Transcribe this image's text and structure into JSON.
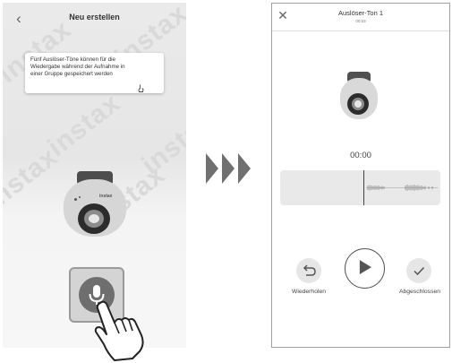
{
  "left_screen": {
    "title": "Neu erstellen",
    "back_icon": "chevron-left-icon",
    "tooltip": {
      "line1": "Fünf Auslöser-Töne können für die",
      "line2": "Wiedergabe während der Aufnahme in",
      "line3": "einer Gruppe gespeichert werden"
    },
    "watermark": "instax",
    "camera_brand": "instax",
    "mic_icon": "microphone-icon"
  },
  "arrow_icon": "triple-chevron-right-icon",
  "right_screen": {
    "title": "Auslöser-Ton 1",
    "subtitle_time": "00:03",
    "close_icon": "close-icon",
    "timer": "00:00",
    "undo_label": "Wiederholen",
    "done_label": "Abgeschlossen",
    "icons": {
      "undo": "undo-icon",
      "play": "play-icon",
      "done": "checkmark-icon"
    }
  },
  "colors": {
    "screen_bg": "#e8e8e8",
    "camera_top": "#4d4d4d",
    "arrow": "#707070",
    "mic_button": "#6e6e6e"
  }
}
